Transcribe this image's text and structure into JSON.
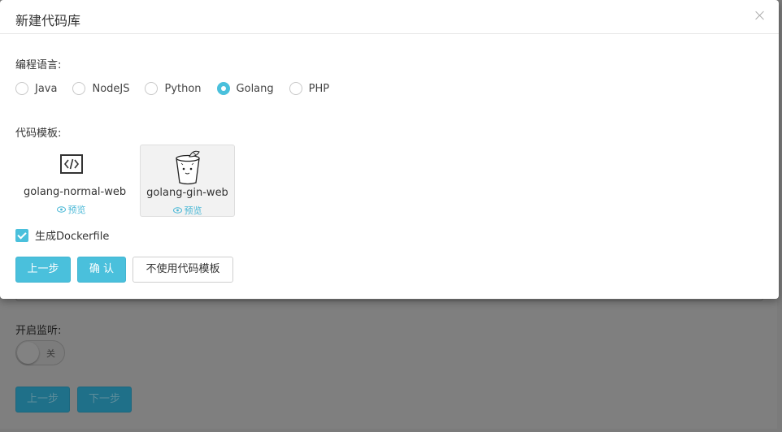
{
  "background": {
    "label_listen": "开启监听:",
    "toggle_off_text": "关",
    "prev_button": "上一步",
    "next_button": "下一步"
  },
  "modal": {
    "title": "新建代码库",
    "language_label": "编程语言:",
    "languages": [
      {
        "label": "Java",
        "checked": false
      },
      {
        "label": "NodeJS",
        "checked": false
      },
      {
        "label": "Python",
        "checked": false
      },
      {
        "label": "Golang",
        "checked": true
      },
      {
        "label": "PHP",
        "checked": false
      }
    ],
    "template_label": "代码模板:",
    "templates": [
      {
        "name": "golang-normal-web",
        "preview": "预览",
        "icon": "code-icon",
        "selected": false
      },
      {
        "name": "golang-gin-web",
        "preview": "预览",
        "icon": "gin-logo-icon",
        "selected": true
      }
    ],
    "dockerfile_checkbox": {
      "label": "生成Dockerfile",
      "checked": true
    },
    "buttons": {
      "prev": "上一步",
      "confirm": "确 认",
      "no_template": "不使用代码模板"
    }
  },
  "colors": {
    "accent": "#4ac0dc",
    "overlay": "#7f7f7f"
  }
}
